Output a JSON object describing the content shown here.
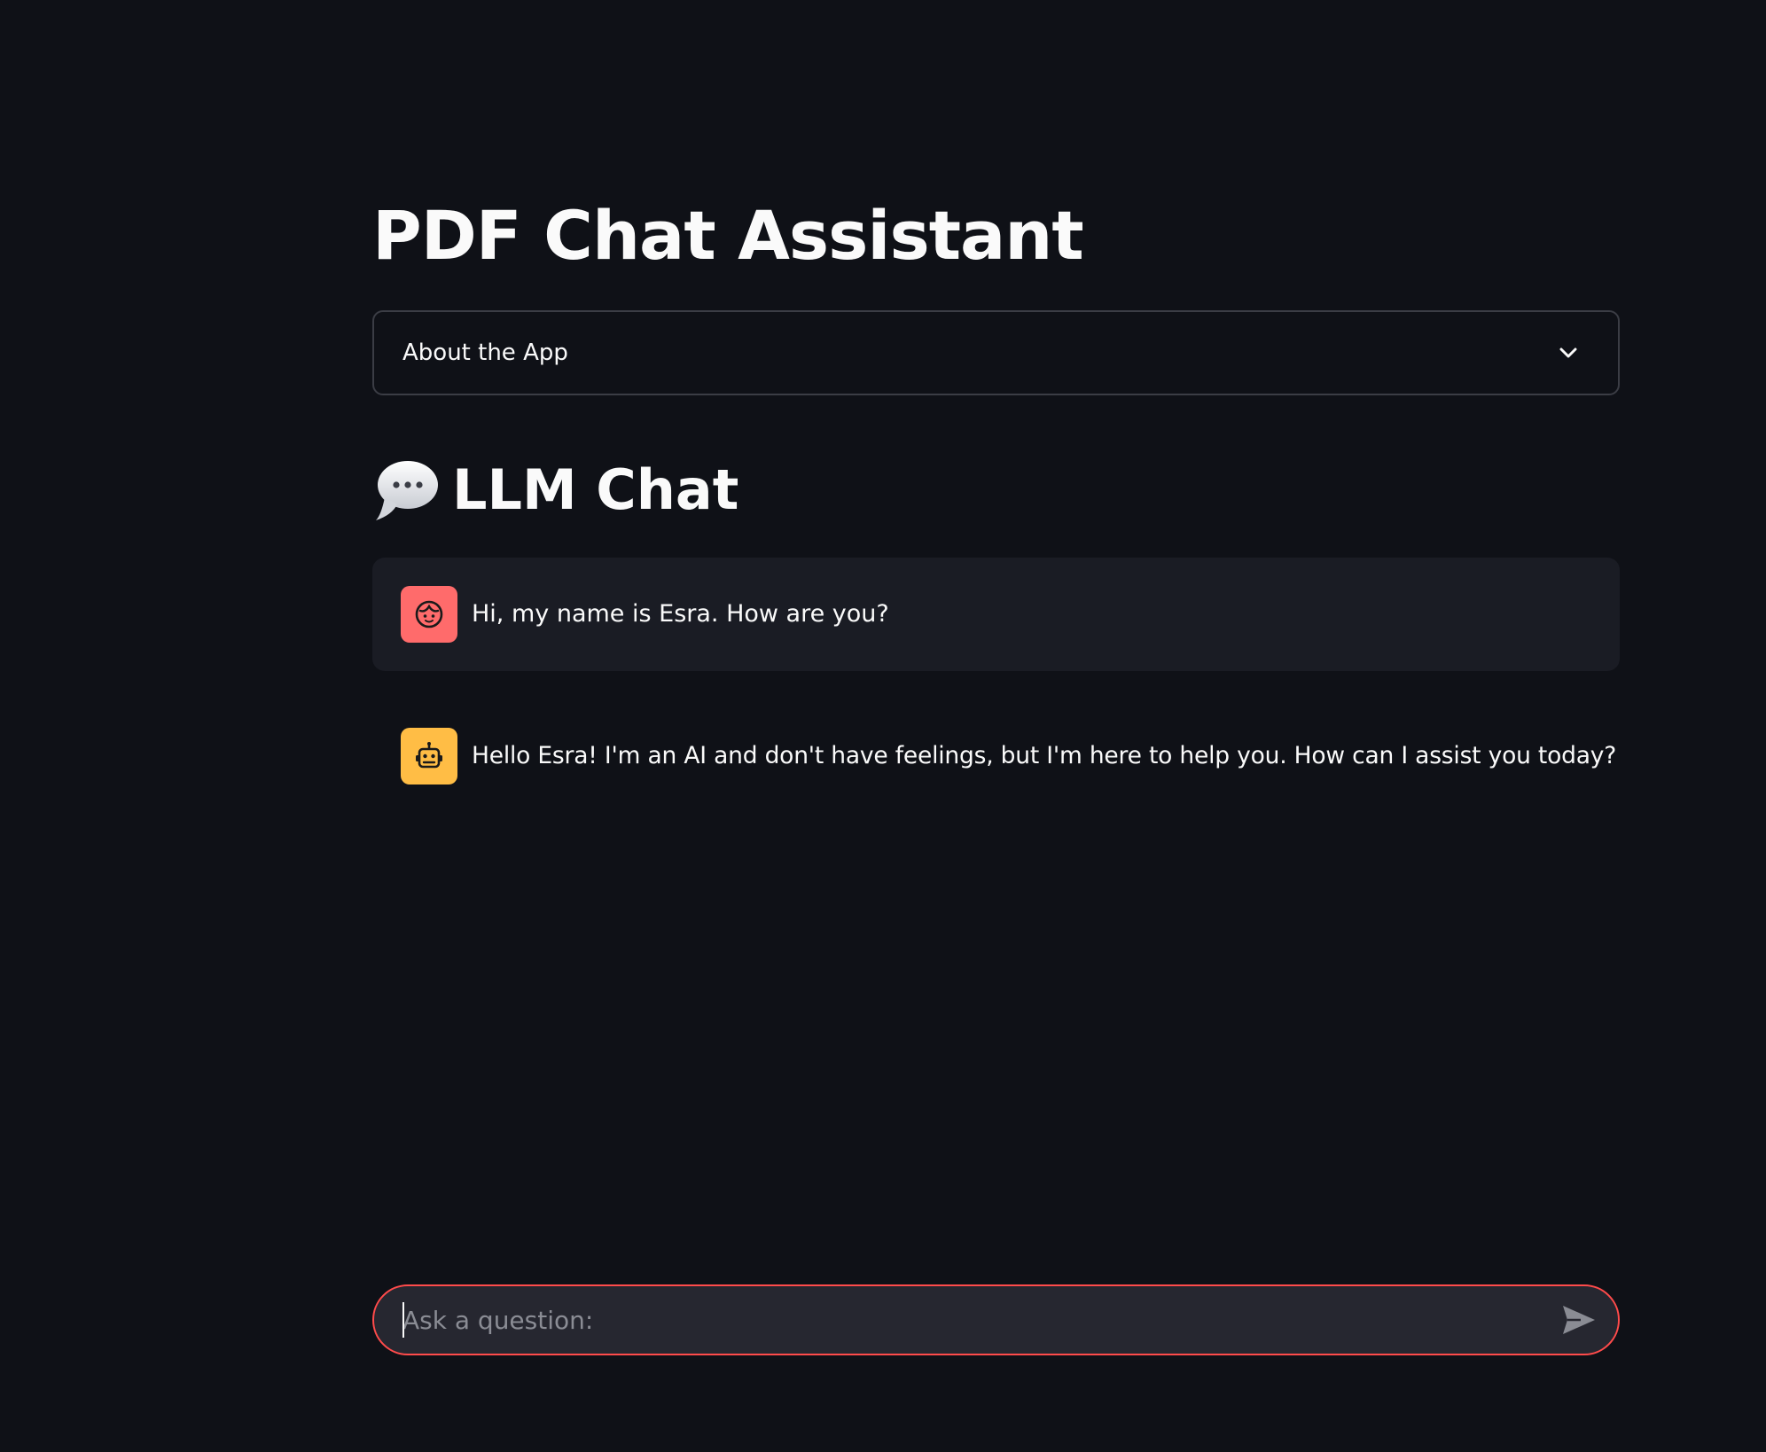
{
  "page": {
    "title": "PDF Chat Assistant"
  },
  "expander": {
    "label": "About the App",
    "icon": "chevron-down-icon"
  },
  "chat_section": {
    "icon": "speech-bubble-icon",
    "title": "LLM Chat"
  },
  "messages": [
    {
      "role": "user",
      "avatar_icon": "user-face-icon",
      "avatar_color": "#ff6b6b",
      "text": "Hi, my name is Esra. How are you?"
    },
    {
      "role": "assistant",
      "avatar_icon": "robot-icon",
      "avatar_color": "#ffbd45",
      "text": "Hello Esra! I'm an AI and don't have feelings, but I'm here to help you. How can I assist you today?"
    }
  ],
  "chat_input": {
    "value": "",
    "placeholder": "Ask a question:",
    "send_icon": "send-icon",
    "border_color": "#ff4b4b"
  },
  "colors": {
    "background": "#0f1117",
    "user_message_bg": "#1a1c24",
    "input_bg": "#262730",
    "text": "#fafafa"
  }
}
